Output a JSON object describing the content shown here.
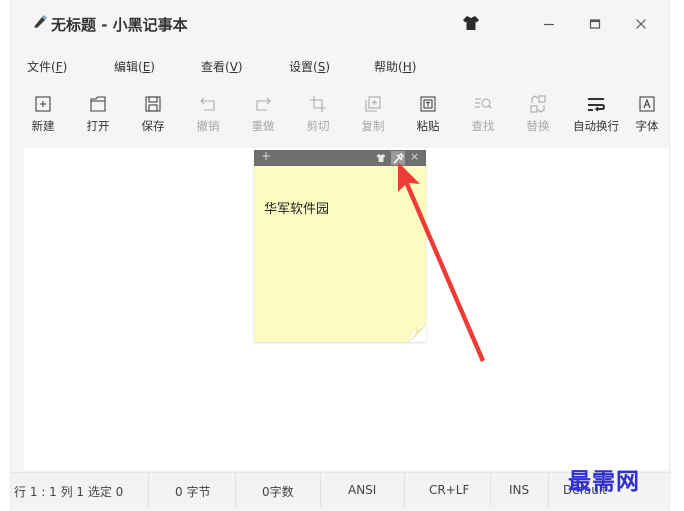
{
  "window": {
    "title": "无标题 - 小黑记事本"
  },
  "menu": [
    {
      "label": "文件(",
      "key": "F",
      "end": ")"
    },
    {
      "label": "编辑(",
      "key": "E",
      "end": ")"
    },
    {
      "label": "查看(",
      "key": "V",
      "end": ")"
    },
    {
      "label": "设置(",
      "key": "S",
      "end": ")"
    },
    {
      "label": "帮助(",
      "key": "H",
      "end": ")"
    }
  ],
  "toolbar": {
    "new": "新建",
    "open": "打开",
    "save": "保存",
    "undo": "撤销",
    "redo": "重做",
    "cut": "剪切",
    "copy": "复制",
    "paste": "粘贴",
    "find": "查找",
    "replace": "替换",
    "wrap": "自动换行",
    "font": "字体"
  },
  "note": {
    "add_symbol": "+",
    "close_symbol": "×",
    "text": "华军软件园",
    "background": "#fdfcc0"
  },
  "status": {
    "position": "行 1 : 1  列 1  选定 0",
    "bytes": "0 字节",
    "chars": "0字数",
    "encoding": "ANSI",
    "line_ending": "CR+LF",
    "mode": "INS",
    "theme": "Default"
  },
  "watermark": "最需网",
  "colors": {
    "arrow": "#ee3b35",
    "watermark": "#2f2fd3"
  }
}
